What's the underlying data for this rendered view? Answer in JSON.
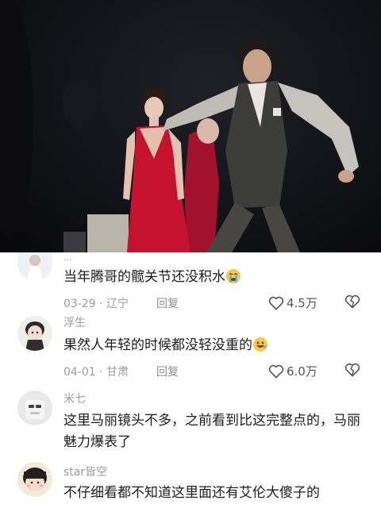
{
  "comments": [
    {
      "username": "...",
      "text": "当年腾哥的髋关节还没积水",
      "date": "03-29",
      "location": "辽宁",
      "reply_label": "回复",
      "likes": "4.5万",
      "emoji": "crying-face"
    },
    {
      "username": "浮生",
      "text": "果然人年轻的时候都没轻没重的",
      "date": "04-01",
      "location": "甘肃",
      "reply_label": "回复",
      "likes": "6.0万",
      "emoji": "grinning-face"
    },
    {
      "username": "米七",
      "text": "这里马丽镜头不多，之前看到比这完整点的，马丽魅力爆表了"
    },
    {
      "username": "star皆空",
      "text": "不仔细看都不知道这里面还有艾伦大傻子的"
    }
  ],
  "separator": " · ",
  "colors": {
    "dress_red": "#c4122f",
    "text_primary": "#1c1c1c",
    "text_secondary": "#9b9b9b"
  }
}
